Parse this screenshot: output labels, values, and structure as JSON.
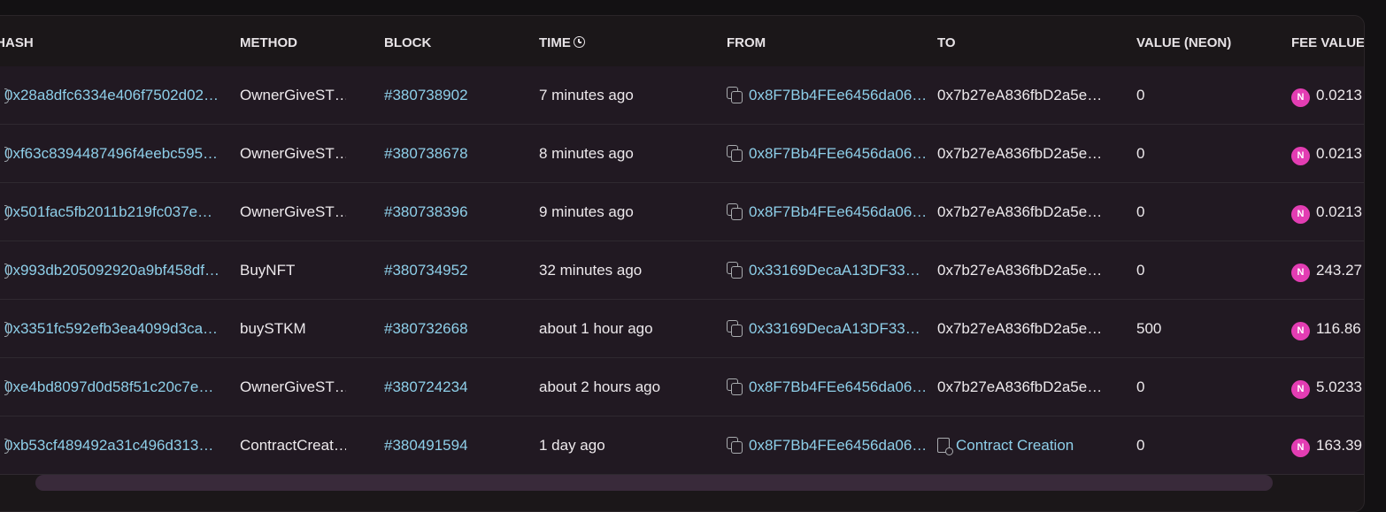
{
  "columns": {
    "hash": "X HASH",
    "method": "METHOD",
    "block": "BLOCK",
    "time": "TIME",
    "from": "FROM",
    "to": "TO",
    "value": "VALUE (NEON)",
    "fee": "FEE VALUE"
  },
  "icons": {
    "hash": "transaction-icon",
    "copy": "copy-icon",
    "contract": "contract-document-icon",
    "neon": "neon-token-icon",
    "time": "clock-icon"
  },
  "colors": {
    "link": "#8ecfe9",
    "neon_badge": "#e33db3",
    "row_bg": "#211922"
  },
  "rows": [
    {
      "hash": "0x28a8dfc6334e406f7502d02…",
      "method": "OwnerGiveST…",
      "block": "#380738902",
      "time": "7 minutes ago",
      "from": "0x8F7Bb4FEe6456da06…",
      "to": "0x7b27eA836fbD2a5e…",
      "value": "0",
      "fee": "0.0213"
    },
    {
      "hash": "0xf63c8394487496f4eebc595…",
      "method": "OwnerGiveST…",
      "block": "#380738678",
      "time": "8 minutes ago",
      "from": "0x8F7Bb4FEe6456da06…",
      "to": "0x7b27eA836fbD2a5e…",
      "value": "0",
      "fee": "0.0213"
    },
    {
      "hash": "0x501fac5fb2011b219fc037e…",
      "method": "OwnerGiveST…",
      "block": "#380738396",
      "time": "9 minutes ago",
      "from": "0x8F7Bb4FEe6456da06…",
      "to": "0x7b27eA836fbD2a5e…",
      "value": "0",
      "fee": "0.0213"
    },
    {
      "hash": "0x993db205092920a9bf458df…",
      "method": "BuyNFT",
      "block": "#380734952",
      "time": "32 minutes ago",
      "from": "0x33169DecaA13DF33…",
      "to": "0x7b27eA836fbD2a5e…",
      "value": "0",
      "fee": "243.27"
    },
    {
      "hash": "0x3351fc592efb3ea4099d3ca…",
      "method": "buySTKM",
      "block": "#380732668",
      "time": "about 1 hour ago",
      "from": "0x33169DecaA13DF33…",
      "to": "0x7b27eA836fbD2a5e…",
      "value": "500",
      "fee": "116.86"
    },
    {
      "hash": "0xe4bd8097d0d58f51c20c7e…",
      "method": "OwnerGiveST…",
      "block": "#380724234",
      "time": "about 2 hours ago",
      "from": "0x8F7Bb4FEe6456da06…",
      "to": "0x7b27eA836fbD2a5e…",
      "value": "0",
      "fee": "5.0233"
    },
    {
      "hash": "0xb53cf489492a31c496d313…",
      "method": "ContractCreat…",
      "block": "#380491594",
      "time": "1 day ago",
      "from": "0x8F7Bb4FEe6456da06…",
      "to": "Contract Creation",
      "value": "0",
      "fee": "163.39"
    }
  ]
}
